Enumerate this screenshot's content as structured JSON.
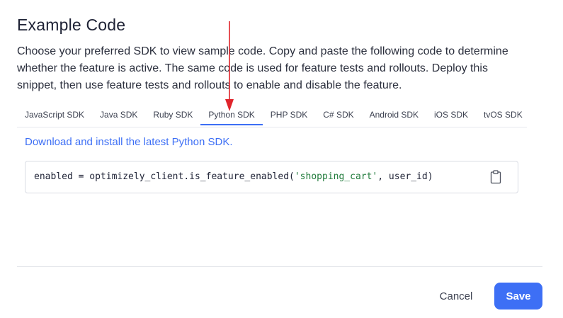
{
  "dialog": {
    "title": "Example Code",
    "description": "Choose your preferred SDK to view sample code. Copy and paste the following code to determine whether the feature is active. The same code is used for feature tests and rollouts. Deploy this snippet, then use feature tests and rollouts to enable and disable the feature."
  },
  "tabs": {
    "items": [
      {
        "label": "JavaScript SDK"
      },
      {
        "label": "Java SDK"
      },
      {
        "label": "Ruby SDK"
      },
      {
        "label": "Python SDK"
      },
      {
        "label": "PHP SDK"
      },
      {
        "label": "C# SDK"
      },
      {
        "label": "Android SDK"
      },
      {
        "label": "iOS SDK"
      },
      {
        "label": "tvOS SDK"
      }
    ],
    "active_index": 3
  },
  "content": {
    "download_link": "Download and install the latest Python SDK.",
    "code": {
      "prefix": "enabled = optimizely_client.is_feature_enabled(",
      "string_arg": "'shopping_cart'",
      "suffix": ", user_id)"
    },
    "copy_icon": "clipboard-icon"
  },
  "footer": {
    "cancel_label": "Cancel",
    "save_label": "Save"
  },
  "colors": {
    "accent": "#3d6ff5",
    "code_string": "#1f7a3a",
    "annotation_arrow": "#e0242b"
  }
}
